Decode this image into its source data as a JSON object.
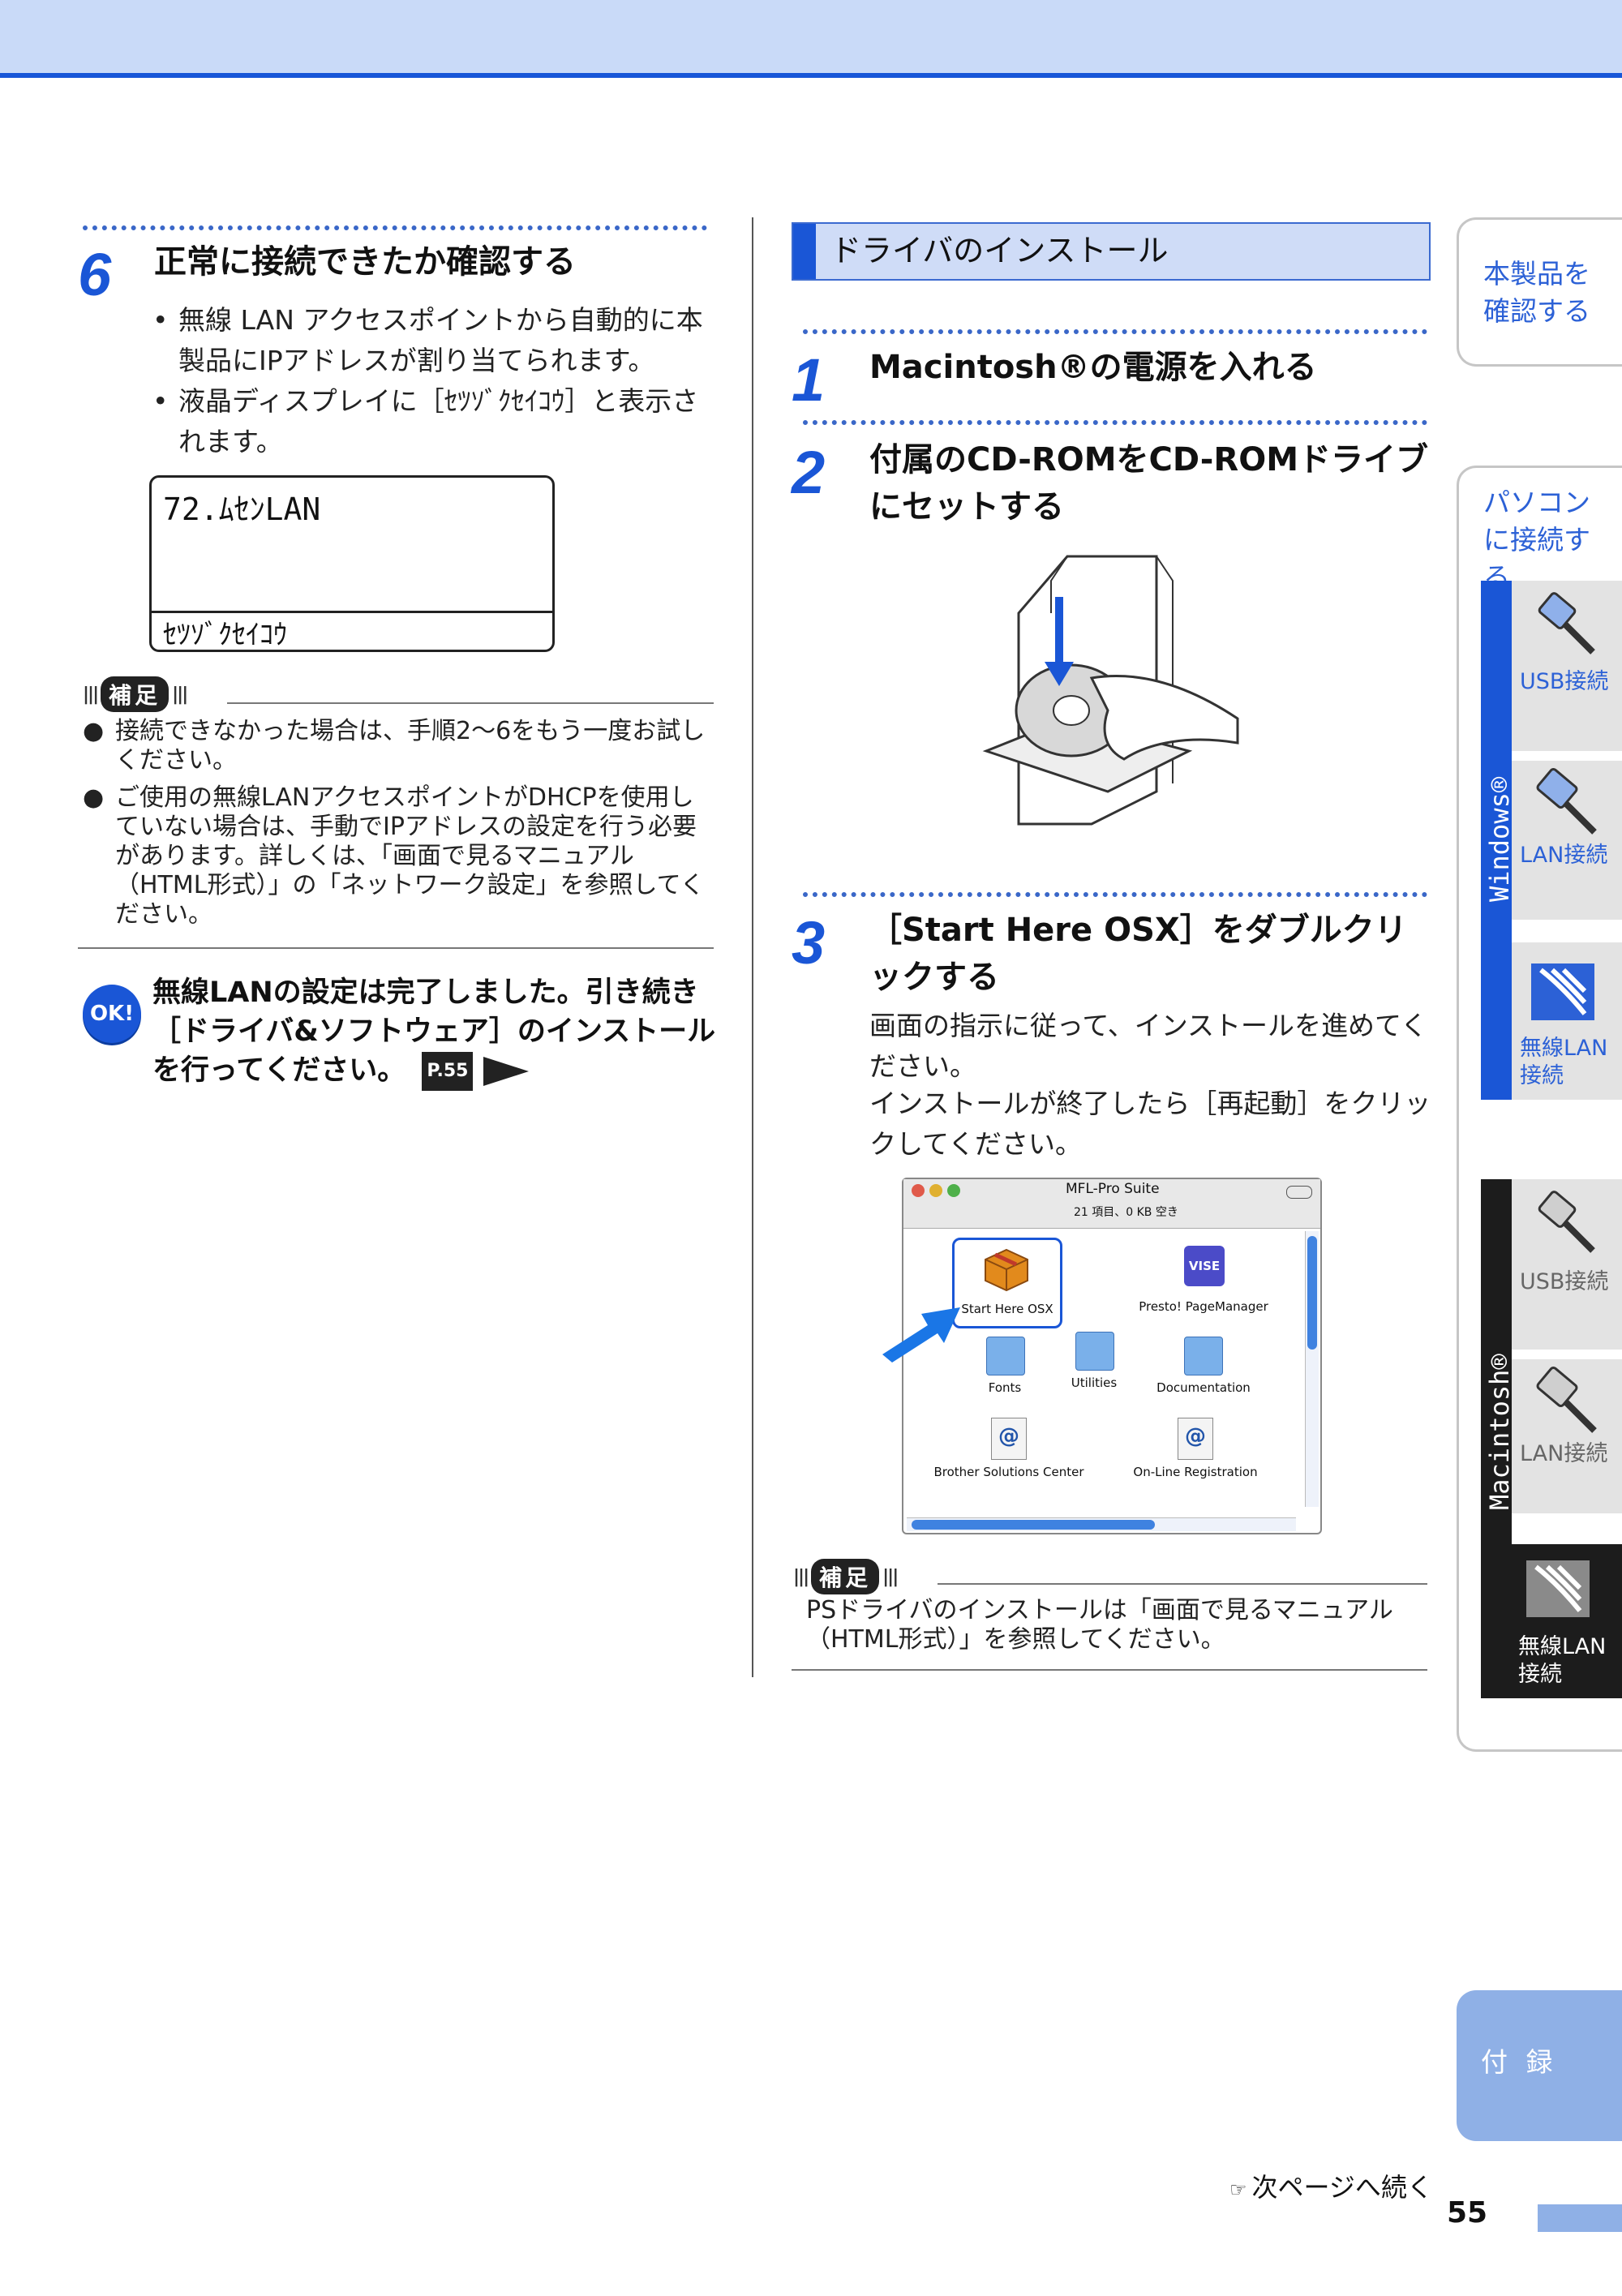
{
  "left": {
    "step6": {
      "number": "6",
      "title": "正常に接続できたか確認する",
      "bullets": [
        "無線 LAN アクセスポイントから自動的に本製品にIPアドレスが割り当てられます。",
        "液晶ディスプレイに［ｾﾂｿﾞｸｾｲｺｳ］と表示されます。"
      ],
      "bullet_mark": "•"
    },
    "lcd": {
      "line1": "72.ﾑｾﾝLAN",
      "line2": "ｾﾂｿﾞｸｾｲｺｳ"
    },
    "hosoku_label": "補足",
    "notes": [
      "接続できなかった場合は、手順2～6をもう一度お試しください。",
      "ご使用の無線LANアクセスポイントがDHCPを使用していない場合は、手動でIPアドレスの設定を行う必要があります。詳しくは、「画面で見るマニュアル（HTML形式）」の「ネットワーク設定」を参照してください。"
    ],
    "note_mark": "●",
    "ok": {
      "icon": "OK!",
      "text": "無線LANの設定は完了しました。引き続き［ドライバ&ソフトウェア］のインストールを行ってください。",
      "page_ref": "P.55"
    }
  },
  "right": {
    "section_title": "ドライバのインストール",
    "step1": {
      "number": "1",
      "title": "Macintosh®の電源を入れる"
    },
    "step2": {
      "number": "2",
      "title": "付属のCD-ROMをCD-ROMドライブにセットする"
    },
    "step3": {
      "number": "3",
      "title": "［Start Here OSX］をダブルクリックする",
      "body1": "画面の指示に従って、インストールを進めてください。",
      "body2": "インストールが終了したら［再起動］をクリックしてください。"
    },
    "finder": {
      "title": "MFL-Pro Suite",
      "status": "21 項目、0 KB 空き",
      "icons": [
        "Start Here OSX",
        "Presto! PageManager",
        "Fonts",
        "Utilities",
        "Documentation",
        "Brother Solutions Center",
        "On-Line Registration"
      ]
    },
    "hosoku_label": "補足",
    "note": "PSドライバのインストールは「画面で見るマニュアル（HTML形式）」を参照してください。"
  },
  "sidebar": {
    "tab1": "本製品を確認する",
    "tab2": "パソコンに接続する",
    "windows_label": "Windows®",
    "macintosh_label": "Macintosh®",
    "usb": "USB接続",
    "lan": "LAN接続",
    "wlan": "無線LAN接続",
    "appendix": "付 録"
  },
  "footer": {
    "next": "次ページへ続く",
    "page": "55"
  },
  "colors": {
    "accent": "#1a56d6",
    "header_bg": "#c9daf8",
    "dark_tab": "#1c1c1c"
  }
}
